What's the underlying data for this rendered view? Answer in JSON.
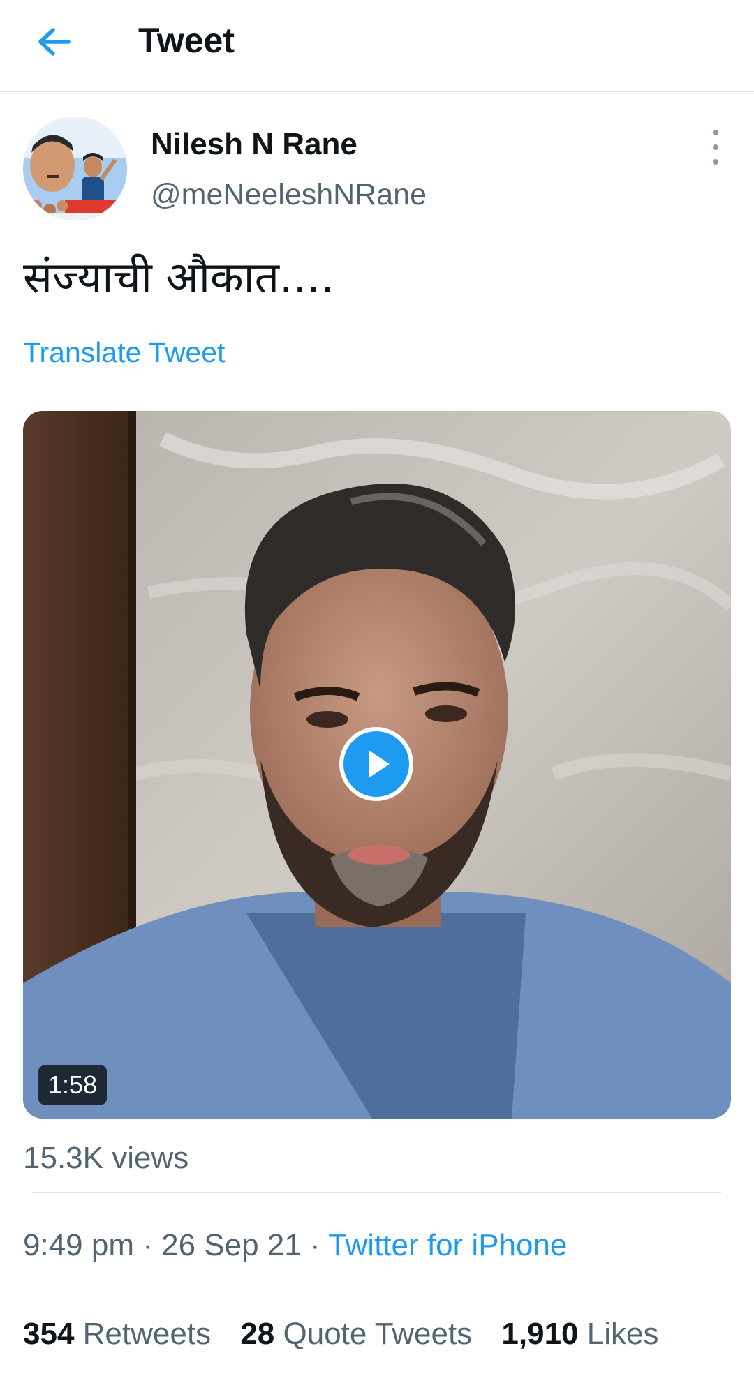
{
  "header": {
    "title": "Tweet",
    "back_icon": "arrow-left-icon"
  },
  "tweet": {
    "author_name": "Nilesh N Rane",
    "author_handle": "@meNeeleshNRane",
    "text": "संज्याची औकात....",
    "translate_label": "Translate Tweet",
    "video_duration": "1:58",
    "views": "15.3K views",
    "time": "9:49 pm",
    "date": "26 Sep 21",
    "source": "Twitter for iPhone",
    "separator": "·"
  },
  "stats": {
    "retweets_count": "354",
    "retweets_label": "Retweets",
    "quotes_count": "28",
    "quotes_label": "Quote Tweets",
    "likes_count": "1,910",
    "likes_label": "Likes"
  },
  "colors": {
    "accent": "#1d9bf0",
    "secondary_text": "#536471",
    "primary_text": "#0f1419"
  }
}
